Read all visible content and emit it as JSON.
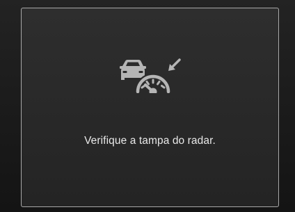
{
  "message": {
    "text": "Verifique a tampa do radar.",
    "icon": "radar-sensor-blocked-icon"
  },
  "colors": {
    "panel_border": "#a9a9a9",
    "icon": "#b5b5b5",
    "text": "#e9e9e9",
    "background": "#1c1c1c"
  }
}
